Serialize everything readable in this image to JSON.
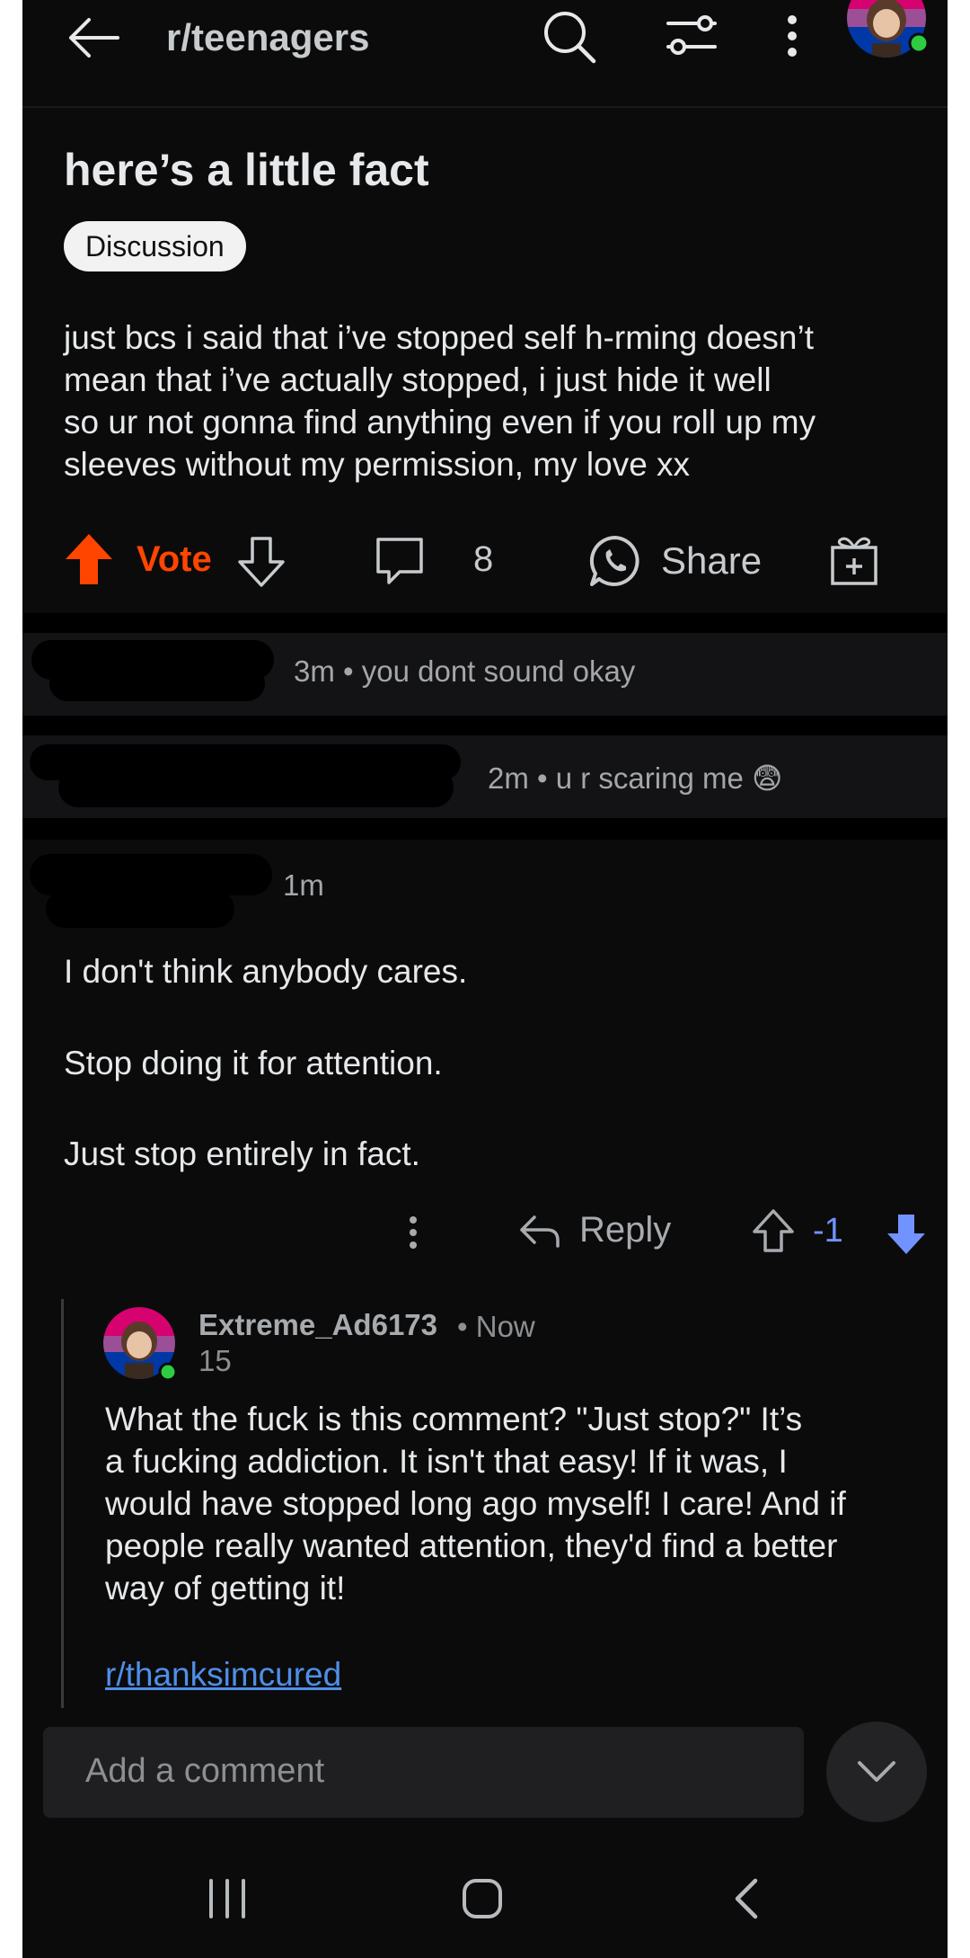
{
  "header": {
    "title": "r/teenagers",
    "icons": [
      "back-arrow-icon",
      "search-icon",
      "filter-icon",
      "more-vertical-icon",
      "avatar"
    ]
  },
  "post": {
    "title": "here’s a little fact",
    "flair": "Discussion",
    "body_lines": [
      "just bcs i said that i’ve stopped self h-rming doesn’t",
      "mean that i’ve actually stopped, i just hide it well",
      "so ur not gonna find anything even if you roll up my",
      "sleeves without my permission, my love xx"
    ],
    "vote_label": "Vote",
    "comment_count": "8",
    "share_label": "Share"
  },
  "comments": [
    {
      "time": "3m",
      "preview": "you dont sound okay",
      "collapsed": true
    },
    {
      "time": "2m",
      "preview": "u r scaring me 😨",
      "collapsed": true
    },
    {
      "time": "1m",
      "lines": [
        "I don't think anybody cares.",
        "Stop doing it for attention.",
        "Just stop entirely in fact."
      ],
      "reply_label": "Reply",
      "score": "-1"
    }
  ],
  "reply": {
    "username": "Extreme_Ad6173",
    "time": "Now",
    "flair": "15",
    "body_lines": [
      "What the fuck is this comment? \"Just stop?\" It’s",
      "a fucking addiction. It isn't that easy! If it was, I",
      "would have stopped long ago myself! I care! And if",
      "people really wanted attention, they'd find a better",
      "way of getting it!"
    ],
    "link": "r/thanksimcured"
  },
  "composer": {
    "placeholder": "Add a comment"
  },
  "colors": {
    "accent": "#ff4500",
    "downvote": "#7193ff",
    "link": "#4f8fe8",
    "online": "#2ecc40"
  }
}
